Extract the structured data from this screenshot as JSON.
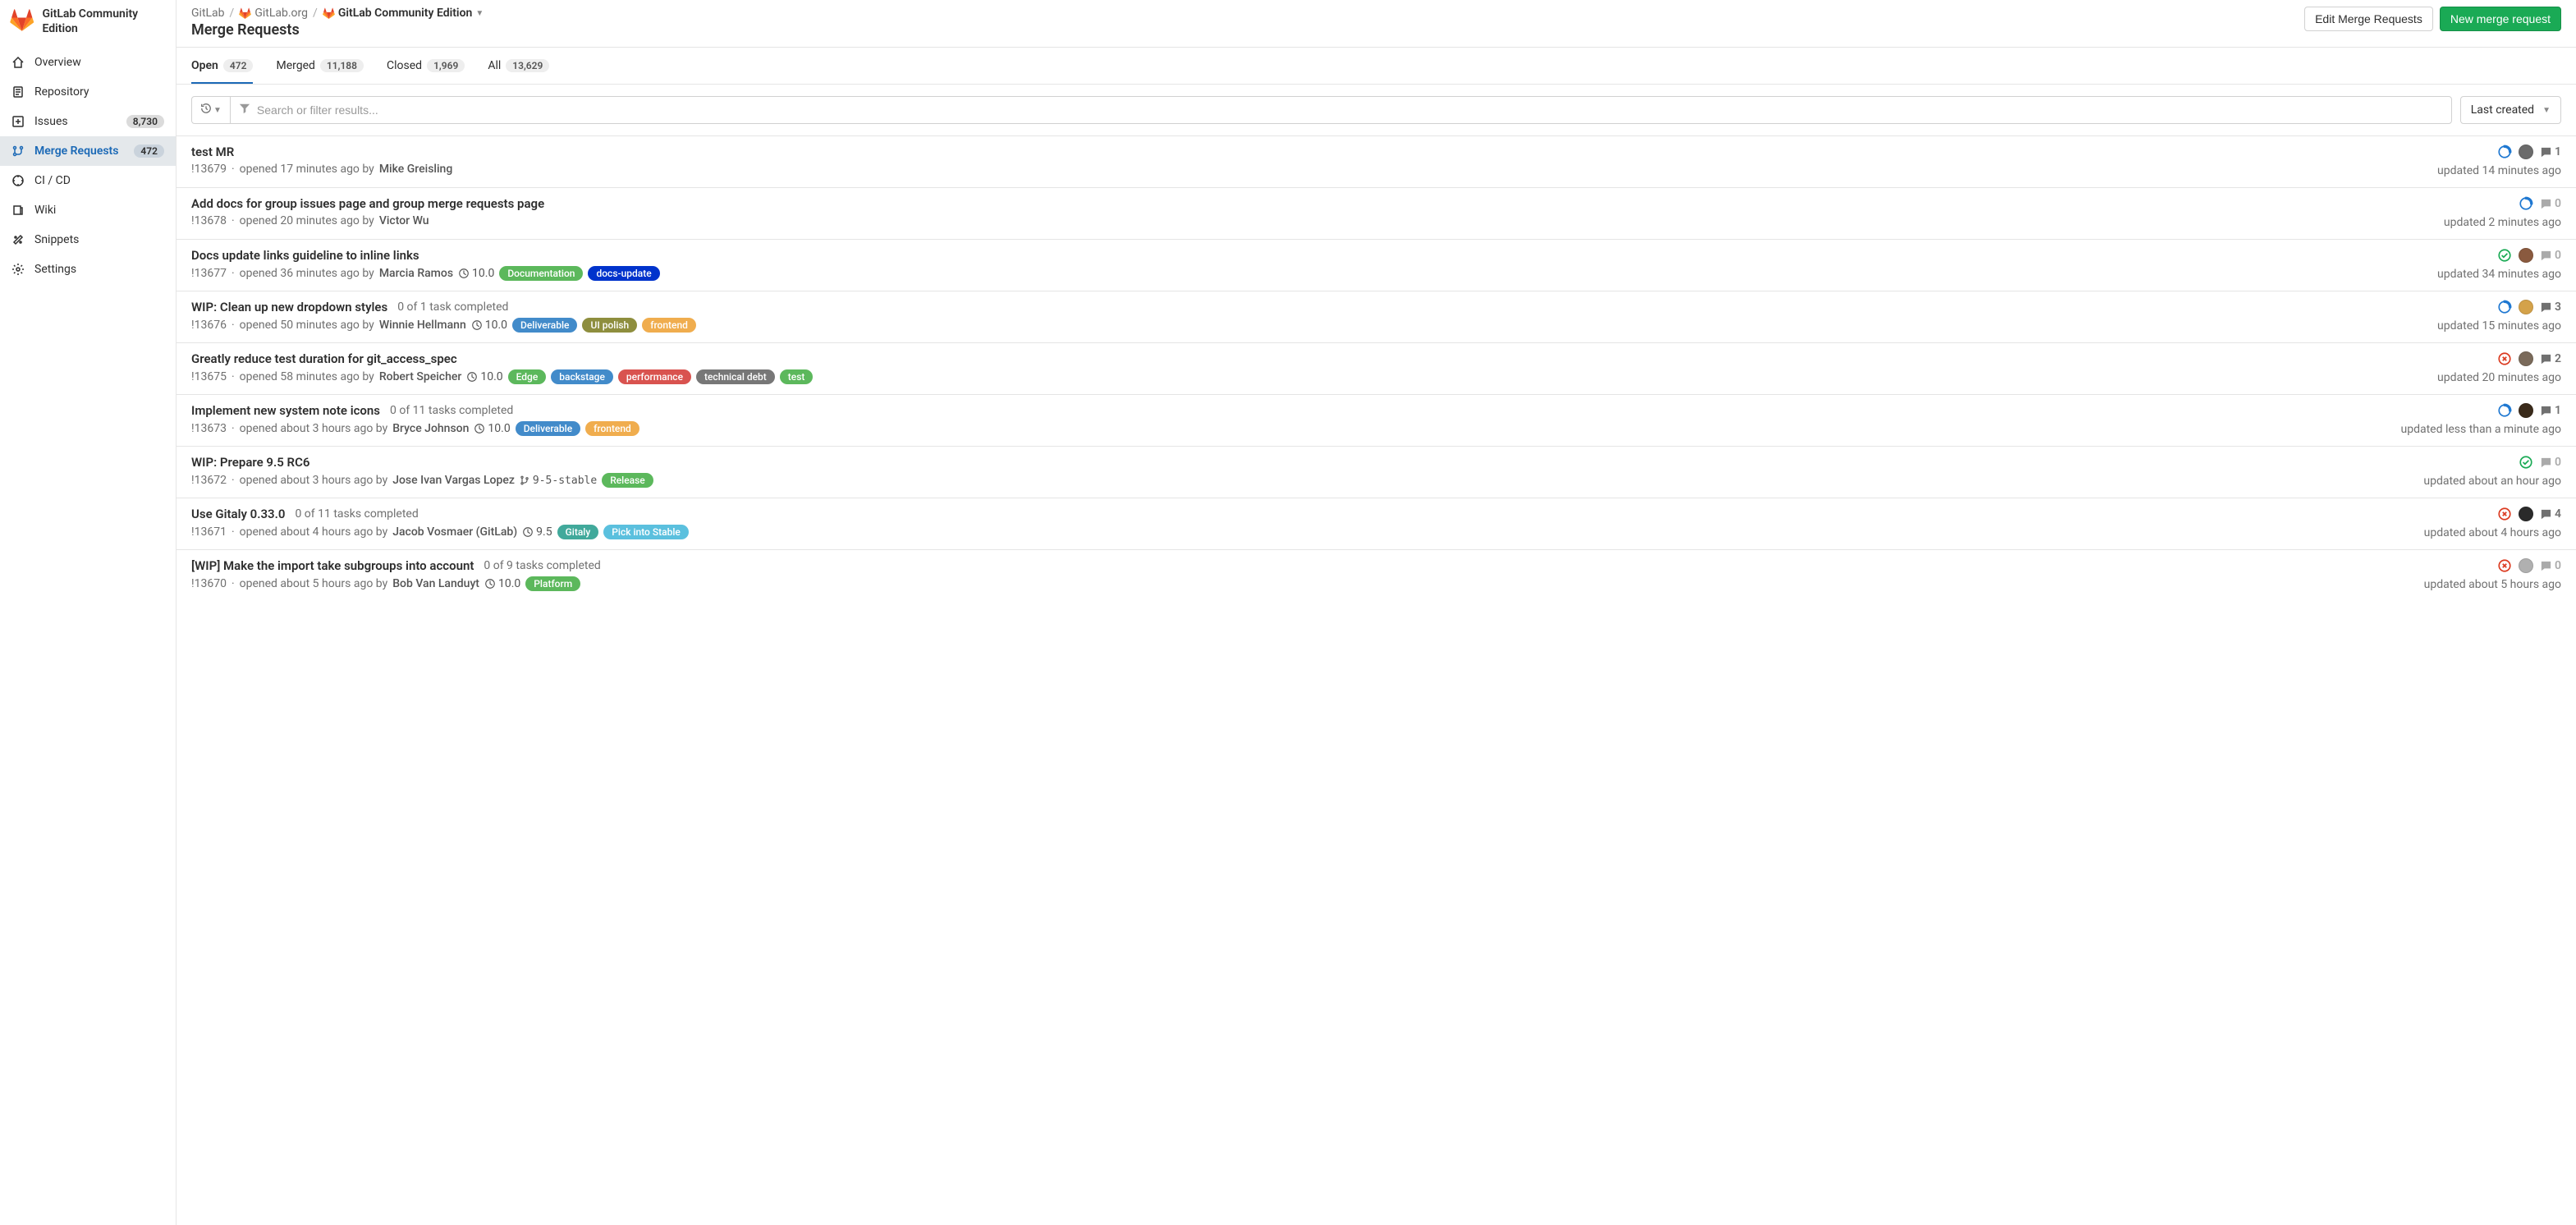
{
  "sidebar": {
    "project_name": "GitLab Community Edition",
    "items": [
      {
        "label": "Overview",
        "badge": null
      },
      {
        "label": "Repository",
        "badge": null
      },
      {
        "label": "Issues",
        "badge": "8,730"
      },
      {
        "label": "Merge Requests",
        "badge": "472"
      },
      {
        "label": "CI / CD",
        "badge": null
      },
      {
        "label": "Wiki",
        "badge": null
      },
      {
        "label": "Snippets",
        "badge": null
      },
      {
        "label": "Settings",
        "badge": null
      }
    ]
  },
  "breadcrumbs": {
    "root": "GitLab",
    "group": "GitLab.org",
    "project": "GitLab Community Edition"
  },
  "page_title": "Merge Requests",
  "actions": {
    "edit": "Edit Merge Requests",
    "new": "New merge request"
  },
  "tabs": [
    {
      "label": "Open",
      "count": "472"
    },
    {
      "label": "Merged",
      "count": "11,188"
    },
    {
      "label": "Closed",
      "count": "1,969"
    },
    {
      "label": "All",
      "count": "13,629"
    }
  ],
  "filter": {
    "placeholder": "Search or filter results...",
    "sort": "Last created"
  },
  "label_colors": {
    "Documentation": "#5cb85c",
    "docs-update": "#0033cc",
    "Deliverable": "#428bca",
    "UI polish": "#8e8e3e",
    "frontend": "#f0ad4e",
    "Edge": "#5cb85c",
    "backstage": "#428bca",
    "performance": "#d9534f",
    "technical debt": "#777777",
    "test": "#5cb85c",
    "Release": "#5cb85c",
    "Gitaly": "#41a99b",
    "Pick into Stable": "#5bc0de",
    "Platform": "#5cb85c"
  },
  "mrs": [
    {
      "title": "test MR",
      "tasks": null,
      "ref": "!13679",
      "opened": "opened 17 minutes ago by",
      "author": "Mike Greisling",
      "milestone": null,
      "branch": null,
      "labels": [],
      "status": "running",
      "assignee": true,
      "assignee_color": "#6b6b6b",
      "comments": "1",
      "comments_zero": false,
      "updated": "updated 14 minutes ago"
    },
    {
      "title": "Add docs for group issues page and group merge requests page",
      "tasks": null,
      "ref": "!13678",
      "opened": "opened 20 minutes ago by",
      "author": "Victor Wu",
      "milestone": null,
      "branch": null,
      "labels": [],
      "status": "running",
      "assignee": false,
      "assignee_color": "",
      "comments": "0",
      "comments_zero": true,
      "updated": "updated 2 minutes ago"
    },
    {
      "title": "Docs update links guideline to inline links",
      "tasks": null,
      "ref": "!13677",
      "opened": "opened 36 minutes ago by",
      "author": "Marcia Ramos",
      "milestone": "10.0",
      "branch": null,
      "labels": [
        "Documentation",
        "docs-update"
      ],
      "status": "success",
      "assignee": true,
      "assignee_color": "#8a5a3f",
      "comments": "0",
      "comments_zero": true,
      "updated": "updated 34 minutes ago"
    },
    {
      "title": "WIP: Clean up new dropdown styles",
      "tasks": "0 of 1 task completed",
      "ref": "!13676",
      "opened": "opened 50 minutes ago by",
      "author": "Winnie Hellmann",
      "milestone": "10.0",
      "branch": null,
      "labels": [
        "Deliverable",
        "UI polish",
        "frontend"
      ],
      "status": "running",
      "assignee": true,
      "assignee_color": "#d4a24a",
      "comments": "3",
      "comments_zero": false,
      "updated": "updated 15 minutes ago"
    },
    {
      "title": "Greatly reduce test duration for git_access_spec",
      "tasks": null,
      "ref": "!13675",
      "opened": "opened 58 minutes ago by",
      "author": "Robert Speicher",
      "milestone": "10.0",
      "branch": null,
      "labels": [
        "Edge",
        "backstage",
        "performance",
        "technical debt",
        "test"
      ],
      "status": "failed",
      "assignee": true,
      "assignee_color": "#7a6a5a",
      "comments": "2",
      "comments_zero": false,
      "updated": "updated 20 minutes ago"
    },
    {
      "title": "Implement new system note icons",
      "tasks": "0 of 11 tasks completed",
      "ref": "!13673",
      "opened": "opened about 3 hours ago by",
      "author": "Bryce Johnson",
      "milestone": "10.0",
      "branch": null,
      "labels": [
        "Deliverable",
        "frontend"
      ],
      "status": "running",
      "assignee": true,
      "assignee_color": "#3a2a1a",
      "comments": "1",
      "comments_zero": false,
      "updated": "updated less than a minute ago"
    },
    {
      "title": "WIP: Prepare 9.5 RC6",
      "tasks": null,
      "ref": "!13672",
      "opened": "opened about 3 hours ago by",
      "author": "Jose Ivan Vargas Lopez",
      "milestone": null,
      "branch": "9-5-stable",
      "labels": [
        "Release"
      ],
      "status": "success",
      "assignee": false,
      "assignee_color": "",
      "comments": "0",
      "comments_zero": true,
      "updated": "updated about an hour ago"
    },
    {
      "title": "Use Gitaly 0.33.0",
      "tasks": "0 of 11 tasks completed",
      "ref": "!13671",
      "opened": "opened about 4 hours ago by",
      "author": "Jacob Vosmaer (GitLab)",
      "milestone": "9.5",
      "branch": null,
      "labels": [
        "Gitaly",
        "Pick into Stable"
      ],
      "status": "failed",
      "assignee": true,
      "assignee_color": "#2a2a2a",
      "comments": "4",
      "comments_zero": false,
      "updated": "updated about 4 hours ago"
    },
    {
      "title": "[WIP] Make the import take subgroups into account",
      "tasks": "0 of 9 tasks completed",
      "ref": "!13670",
      "opened": "opened about 5 hours ago by",
      "author": "Bob Van Landuyt",
      "milestone": "10.0",
      "branch": null,
      "labels": [
        "Platform"
      ],
      "status": "failed",
      "assignee": true,
      "assignee_color": "#b0b0b0",
      "comments": "0",
      "comments_zero": true,
      "updated": "updated about 5 hours ago"
    }
  ]
}
